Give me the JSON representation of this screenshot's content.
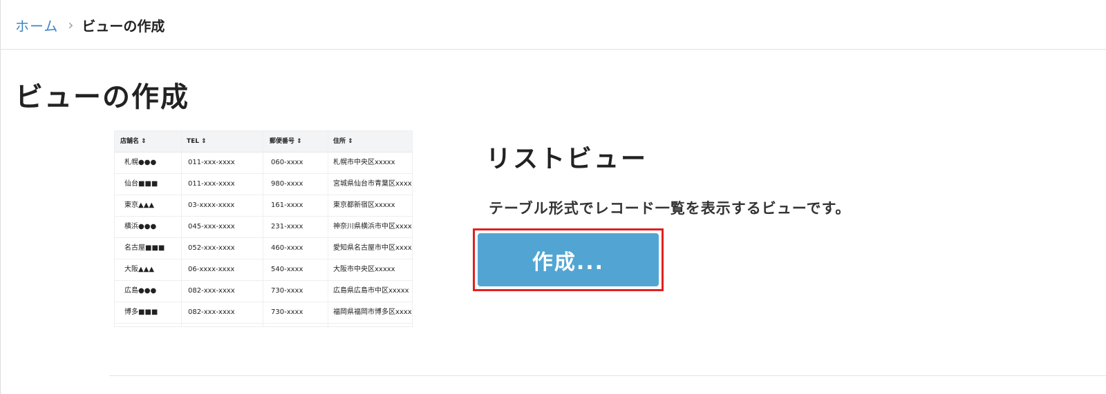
{
  "breadcrumb": {
    "home": "ホーム",
    "separator": "›",
    "current": "ビューの作成"
  },
  "page_title": "ビューの作成",
  "preview_table": {
    "columns": [
      "店舗名 ⇕",
      "TEL ⇕",
      "郵便番号 ⇕",
      "住所 ⇕"
    ],
    "rows": [
      [
        "札幌●●●",
        "011-xxx-xxxx",
        "060-xxxx",
        "札幌市中央区xxxxx"
      ],
      [
        "仙台■■■",
        "011-xxx-xxxx",
        "980-xxxx",
        "宮城県仙台市青葉区xxxx"
      ],
      [
        "東京▲▲▲",
        "03-xxxx-xxxx",
        "161-xxxx",
        "東京都新宿区xxxxx"
      ],
      [
        "横浜●●●",
        "045-xxx-xxxx",
        "231-xxxx",
        "神奈川県横浜市中区xxxx"
      ],
      [
        "名古屋■■■",
        "052-xxx-xxxx",
        "460-xxxx",
        "愛知県名古屋市中区xxxx"
      ],
      [
        "大阪▲▲▲",
        "06-xxxx-xxxx",
        "540-xxxx",
        "大阪市中央区xxxxx"
      ],
      [
        "広島●●●",
        "082-xxx-xxxx",
        "730-xxxx",
        "広島県広島市中区xxxxx"
      ],
      [
        "博多■■■",
        "082-xxx-xxxx",
        "730-xxxx",
        "福岡県福岡市博多区xxxx"
      ]
    ]
  },
  "view": {
    "name": "リストビュー",
    "description": "テーブル形式でレコード一覧を表示するビューです。",
    "create_label": "作成..."
  },
  "colors": {
    "link": "#3b86c6",
    "button": "#52a5d3",
    "highlight": "#e02020"
  }
}
